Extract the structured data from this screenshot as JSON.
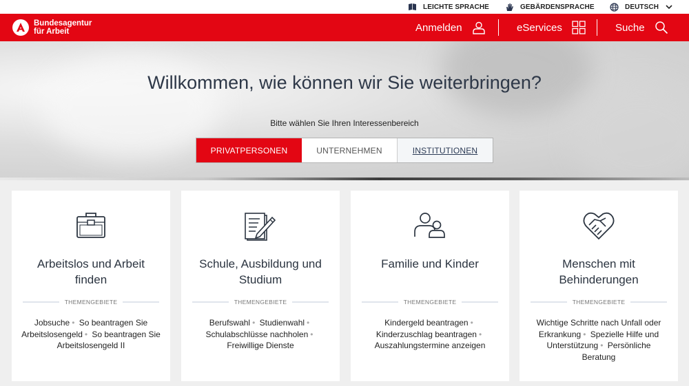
{
  "utility": {
    "leichte_sprache": "LEICHTE SPRACHE",
    "gebaerdensprache": "GEBÄRDENSPRACHE",
    "language": "DEUTSCH"
  },
  "header": {
    "logo_line1": "Bundesagentur",
    "logo_line2": "für Arbeit",
    "nav": {
      "anmelden": "Anmelden",
      "eservices": "eServices",
      "suche": "Suche"
    }
  },
  "hero": {
    "title": "Willkommen, wie können wir Sie weiterbringen?",
    "subtitle": "Bitte wählen Sie Ihren Interessenbereich",
    "tabs": [
      "PRIVATPERSONEN",
      "UNTERNEHMEN",
      "INSTITUTIONEN"
    ],
    "active_tab": "PRIVATPERSONEN"
  },
  "cards": [
    {
      "icon": "briefcase-icon",
      "title_line1": "Arbeitslos und Arbeit",
      "title_line2": "finden",
      "themen_label": "THEMENGEBIETE",
      "links": [
        "Jobsuche",
        "So beantragen Sie Arbeitslosengeld",
        "So beantragen Sie Arbeitslosengeld II"
      ]
    },
    {
      "icon": "document-pen-icon",
      "title_line1": "Schule, Ausbildung und",
      "title_line2": "Studium",
      "themen_label": "THEMENGEBIETE",
      "links": [
        "Berufswahl",
        "Studienwahl",
        "Schulabschlüsse nachholen",
        "Freiwillige Dienste"
      ]
    },
    {
      "icon": "family-icon",
      "title_line1": "Familie und Kinder",
      "title_line2": "",
      "themen_label": "THEMENGEBIETE",
      "links": [
        "Kindergeld beantragen",
        "Kinderzuschlag beantragen",
        "Auszahlungstermine anzeigen"
      ]
    },
    {
      "icon": "heart-handshake-icon",
      "title_line1": "Menschen mit",
      "title_line2": "Behinderungen",
      "themen_label": "THEMENGEBIETE",
      "links": [
        "Wichtige Schritte nach Unfall oder Erkrankung",
        "Spezielle Hilfe und Unterstützung",
        "Persönliche Beratung"
      ]
    }
  ],
  "colors": {
    "brand_red": "#e30613",
    "title_text": "#2e3848",
    "page_bg": "#efefef"
  }
}
